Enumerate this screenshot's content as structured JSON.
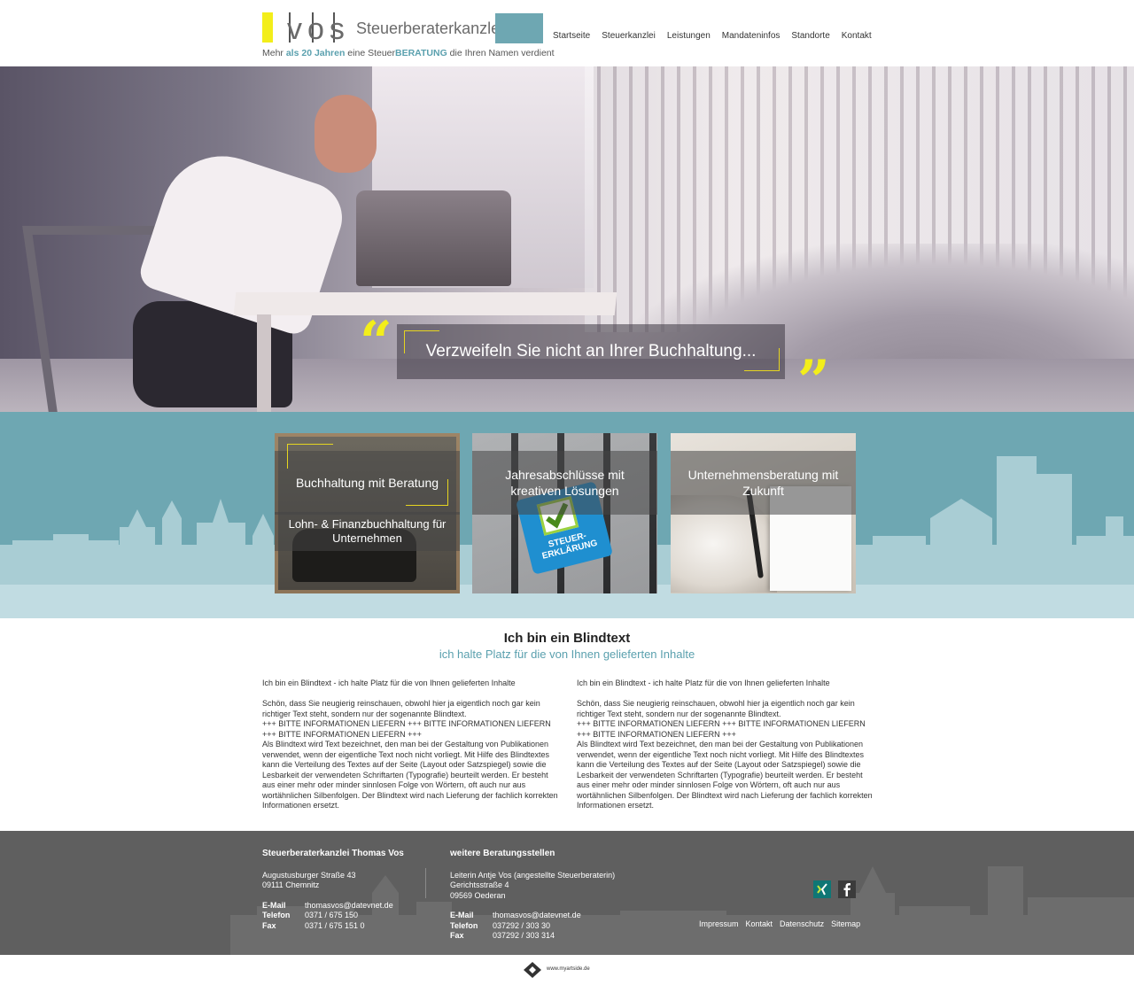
{
  "brand": {
    "logo_letters": "vos",
    "title": "Steuerberaterkanzlei",
    "tagline_pre": "Mehr ",
    "tagline_hl1": "als 20 Jahren",
    "tagline_mid": " eine Steuer",
    "tagline_hl2": "BERATUNG",
    "tagline_post": " die Ihren Namen verdient",
    "accent_yellow": "#f3ee1a",
    "accent_teal": "#6ea7b2"
  },
  "nav": {
    "items": [
      "Startseite",
      "Steuerkanzlei",
      "Leistungen",
      "Mandateninfos",
      "Standorte",
      "Kontakt"
    ]
  },
  "hero": {
    "quote": "Verzweifeln Sie nicht an Ihrer Buchhaltung..."
  },
  "cards": [
    {
      "title": "Buchhaltung mit Beratung",
      "subtitle": "Lohn- & Finanzbuchhaltung für Unternehmen"
    },
    {
      "title": "Jahresabschlüsse mit kreativen Lösungen",
      "key_text": "STEUER-\nERKLÄRUNG"
    },
    {
      "title": "Unternehmensberatung mit Zukunft"
    }
  ],
  "content": {
    "heading": "Ich bin ein Blindtext",
    "subheading": "ich halte Platz für die von Ihnen gelieferten Inhalte",
    "column_text": "Ich bin ein Blindtext - ich halte Platz für die von Ihnen gelieferten Inhalte\n\nSchön, dass Sie neugierig reinschauen, obwohl hier ja eigentlich noch gar kein richtiger Text steht, sondern nur der sogenannte Blindtext.\n+++ BITTE INFORMATIONEN LIEFERN +++ BITTE INFORMATIONEN LIEFERN +++ BITTE INFORMATIONEN LIEFERN +++\nAls Blindtext wird Text bezeichnet, den man bei der Gestaltung von Publikationen verwendet, wenn der eigentliche Text noch nicht vorliegt. Mit Hilfe des Blindtextes kann die Verteilung des Textes auf der Seite (Layout oder Satzspiegel) sowie die Lesbarkeit der verwendeten Schriftarten (Typografie) beurteilt werden. Er besteht aus einer mehr oder minder sinnlosen Folge von Wörtern, oft auch nur aus wortähnlichen Silbenfolgen. Der Blindtext wird nach Lieferung der fachlich korrekten Informationen ersetzt."
  },
  "footer": {
    "main": {
      "heading": "Steuerberaterkanzlei Thomas Vos",
      "street": "Augustusburger Straße 43",
      "city": "09111 Chemnitz",
      "email_label": "E-Mail",
      "email": "thomasvos@datevnet.de",
      "phone_label": "Telefon",
      "phone": "0371 / 675 150",
      "fax_label": "Fax",
      "fax": "0371 / 675 151 0"
    },
    "branch": {
      "heading": "weitere Beratungsstellen",
      "leader": "Leiterin Antje Vos (angestellte Steuerberaterin)",
      "street": "Gerichtsstraße 4",
      "city": "09569 Oederan",
      "email_label": "E-Mail",
      "email": "thomasvos@datevnet.de",
      "phone_label": "Telefon",
      "phone": "037292 / 303 30",
      "fax_label": "Fax",
      "fax": "037292 / 303 314"
    },
    "links": [
      "Impressum",
      "Kontakt",
      "Datenschutz",
      "Sitemap"
    ],
    "social": [
      "xing-icon",
      "facebook-icon"
    ]
  },
  "credit": "www.myartside.de"
}
